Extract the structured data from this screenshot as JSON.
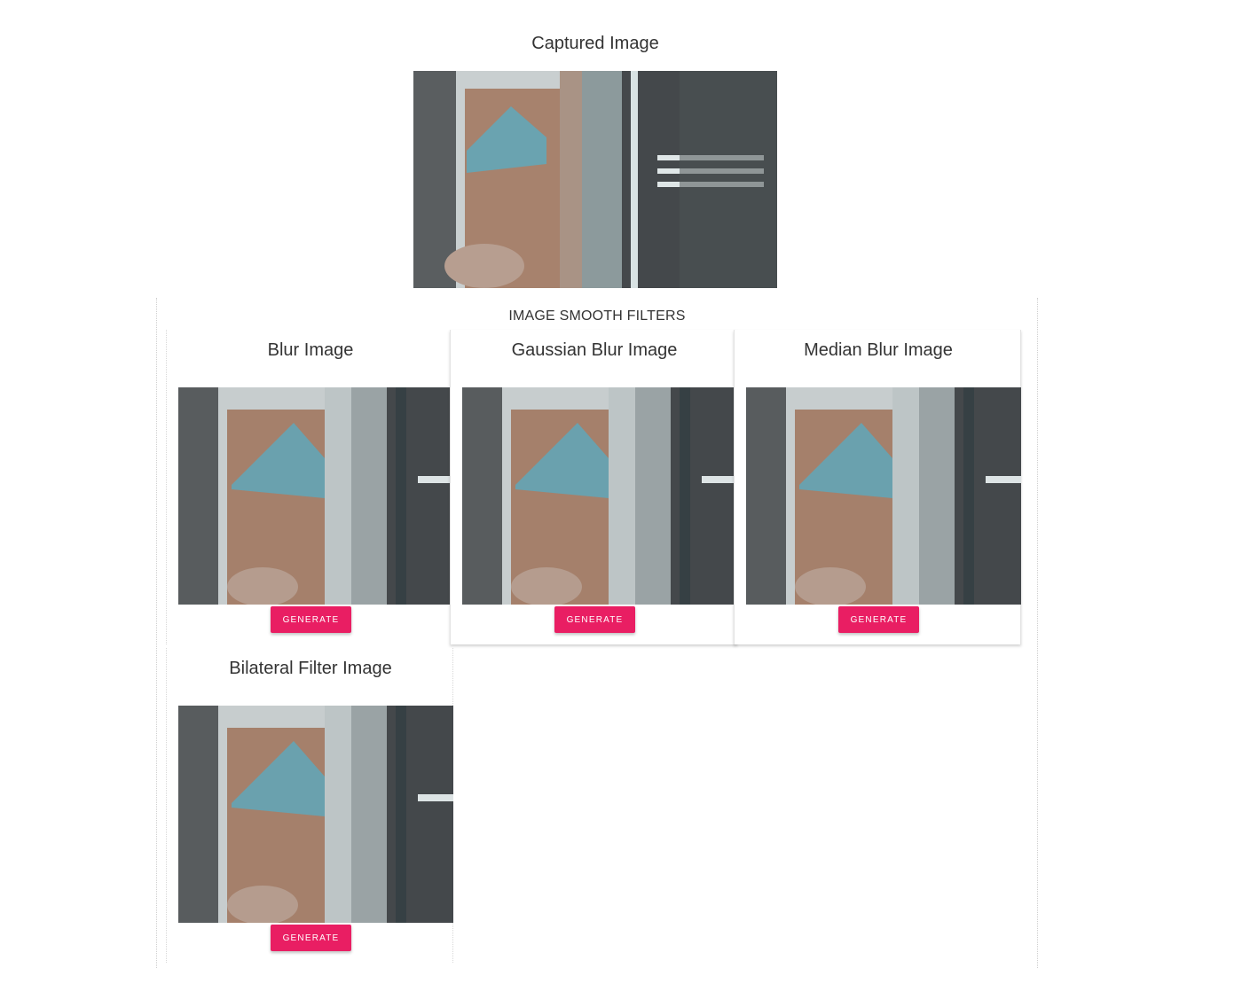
{
  "captured": {
    "title": "Captured Image"
  },
  "filters": {
    "heading": "IMAGE SMOOTH FILTERS",
    "cards": [
      {
        "title": "Blur Image",
        "button": "GENERATE"
      },
      {
        "title": "Gaussian Blur Image",
        "button": "GENERATE"
      },
      {
        "title": "Median Blur Image",
        "button": "GENERATE"
      },
      {
        "title": "Bilateral Filter Image",
        "button": "GENERATE"
      }
    ]
  },
  "colors": {
    "accent": "#e91e63",
    "text": "#333333"
  },
  "photo_description_free": true
}
